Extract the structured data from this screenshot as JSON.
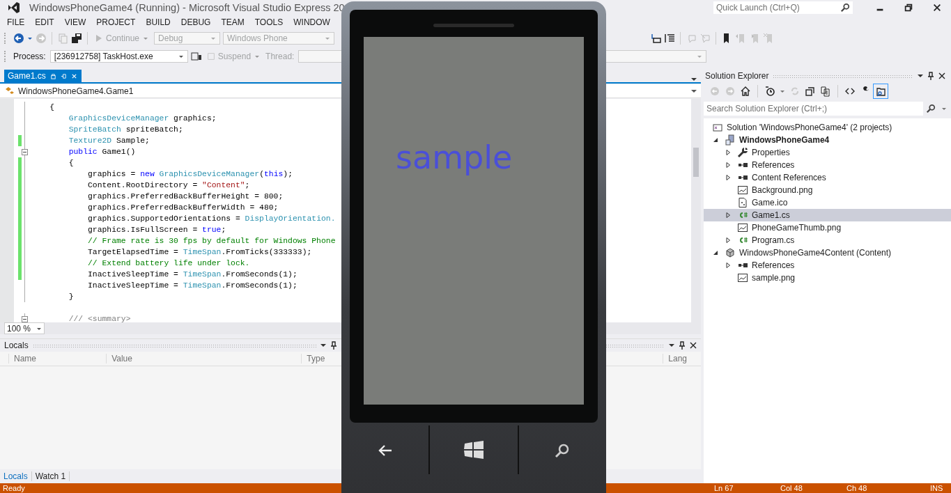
{
  "window": {
    "title": "WindowsPhoneGame4 (Running) - Microsoft Visual Studio Express 20",
    "quick_launch": {
      "placeholder": "Quick Launch (Ctrl+Q)"
    }
  },
  "menu": [
    "FILE",
    "EDIT",
    "VIEW",
    "PROJECT",
    "BUILD",
    "DEBUG",
    "TEAM",
    "TOOLS",
    "WINDOW"
  ],
  "toolbar": {
    "continue": "Continue",
    "configuration": "Debug",
    "platform": "Windows Phone",
    "process_label": "Process:",
    "process": "[236912758] TaskHost.exe",
    "suspend": "Suspend",
    "thread_label": "Thread:"
  },
  "editor": {
    "tabs": [
      {
        "label": "Game1.cs",
        "selected": true
      }
    ],
    "navigation": "WindowsPhoneGame4.Game1",
    "zoom": "100 %",
    "lines": [
      {
        "kind": "class",
        "changed": false,
        "fold": false,
        "tokens": [
          {
            "kind": "plain",
            "text": "{"
          }
        ]
      },
      {
        "kind": "member",
        "changed": false,
        "fold": false,
        "tokens": [
          {
            "kind": "type",
            "text": "GraphicsDeviceManager"
          },
          {
            "kind": "plain",
            "text": " graphics;"
          }
        ]
      },
      {
        "kind": "member",
        "changed": false,
        "fold": false,
        "tokens": [
          {
            "kind": "type",
            "text": "SpriteBatch"
          },
          {
            "kind": "plain",
            "text": " spriteBatch;"
          }
        ]
      },
      {
        "kind": "member",
        "changed": true,
        "fold": false,
        "tokens": [
          {
            "kind": "type",
            "text": "Texture2D"
          },
          {
            "kind": "plain",
            "text": " Sample;"
          }
        ]
      },
      {
        "kind": "member",
        "changed": false,
        "fold": true,
        "tokens": [
          {
            "kind": "keyword",
            "text": "public"
          },
          {
            "kind": "plain",
            "text": " Game1()"
          }
        ]
      },
      {
        "kind": "member",
        "changed": true,
        "fold": false,
        "tokens": [
          {
            "kind": "plain",
            "text": "{"
          }
        ]
      },
      {
        "kind": "statement",
        "changed": true,
        "fold": false,
        "tokens": [
          {
            "kind": "plain",
            "text": "graphics = "
          },
          {
            "kind": "keyword",
            "text": "new"
          },
          {
            "kind": "type",
            "text": " GraphicsDeviceManager"
          },
          {
            "kind": "plain",
            "text": "("
          },
          {
            "kind": "keyword",
            "text": "this"
          },
          {
            "kind": "plain",
            "text": ");"
          }
        ]
      },
      {
        "kind": "statement",
        "changed": true,
        "fold": false,
        "tokens": [
          {
            "kind": "plain",
            "text": "Content.RootDirectory = "
          },
          {
            "kind": "string",
            "text": "\"Content\""
          },
          {
            "kind": "plain",
            "text": ";"
          }
        ]
      },
      {
        "kind": "statement",
        "changed": true,
        "fold": false,
        "tokens": [
          {
            "kind": "plain",
            "text": "graphics.PreferredBackBufferHeight = 800;"
          }
        ]
      },
      {
        "kind": "statement",
        "changed": true,
        "fold": false,
        "tokens": [
          {
            "kind": "plain",
            "text": "graphics.PreferredBackBufferWidth = 480;"
          }
        ]
      },
      {
        "kind": "statement",
        "changed": true,
        "fold": false,
        "tokens": [
          {
            "kind": "plain",
            "text": "graphics.SupportedOrientations = "
          },
          {
            "kind": "type",
            "text": "DisplayOrientation."
          }
        ]
      },
      {
        "kind": "statement",
        "changed": true,
        "fold": false,
        "tokens": [
          {
            "kind": "plain",
            "text": "graphics.IsFullScreen = "
          },
          {
            "kind": "keyword",
            "text": "true"
          },
          {
            "kind": "plain",
            "text": ";"
          }
        ]
      },
      {
        "kind": "statement",
        "changed": true,
        "fold": false,
        "tokens": [
          {
            "kind": "comment",
            "text": "// Frame rate is 30 fps by default for Windows Phone"
          }
        ]
      },
      {
        "kind": "statement",
        "changed": true,
        "fold": false,
        "tokens": [
          {
            "kind": "plain",
            "text": "TargetElapsedTime = "
          },
          {
            "kind": "type",
            "text": "TimeSpan"
          },
          {
            "kind": "plain",
            "text": ".FromTicks(333333);"
          }
        ]
      },
      {
        "kind": "statement",
        "changed": true,
        "fold": false,
        "tokens": [
          {
            "kind": "comment",
            "text": "// Extend battery life under lock."
          }
        ]
      },
      {
        "kind": "statement",
        "changed": true,
        "fold": false,
        "tokens": [
          {
            "kind": "plain",
            "text": "InactiveSleepTime = "
          },
          {
            "kind": "type",
            "text": "TimeSpan"
          },
          {
            "kind": "plain",
            "text": ".FromSeconds(1);"
          }
        ]
      },
      {
        "kind": "statement",
        "changed": false,
        "fold": false,
        "tokens": [
          {
            "kind": "plain",
            "text": "InactiveSleepTime = "
          },
          {
            "kind": "type",
            "text": "TimeSpan"
          },
          {
            "kind": "plain",
            "text": ".FromSeconds(1);"
          }
        ]
      },
      {
        "kind": "member",
        "changed": false,
        "fold": false,
        "tokens": [
          {
            "kind": "plain",
            "text": "}"
          }
        ]
      },
      {
        "kind": "member_spaced",
        "changed": false,
        "fold": true,
        "tokens": [
          {
            "kind": "doc",
            "text": "/// <summary>"
          }
        ]
      }
    ]
  },
  "locals": {
    "title": "Locals",
    "columns": [
      "Name",
      "Value",
      "Type"
    ]
  },
  "second_panel": {
    "columns": [
      "Lang"
    ]
  },
  "bottom_tabs": [
    {
      "label": "Locals",
      "selected": true
    },
    {
      "label": "Watch 1",
      "selected": false
    }
  ],
  "solution_explorer": {
    "title": "Solution Explorer",
    "search": {
      "placeholder": "Search Solution Explorer (Ctrl+;)"
    },
    "tree": [
      {
        "label": "Solution 'WindowsPhoneGame4' (2 projects)",
        "kind": "solution",
        "selected": false,
        "children": [
          {
            "label": "WindowsPhoneGame4",
            "kind": "project",
            "expanded": true,
            "selected": false,
            "children": [
              {
                "label": "Properties",
                "kind": "properties",
                "expanded": false,
                "selected": false
              },
              {
                "label": "References",
                "kind": "references",
                "expanded": false,
                "selected": false
              },
              {
                "label": "Content References",
                "kind": "references",
                "expanded": false,
                "selected": false
              },
              {
                "label": "Background.png",
                "kind": "image",
                "selected": false
              },
              {
                "label": "Game.ico",
                "kind": "ico",
                "selected": false
              },
              {
                "label": "Game1.cs",
                "kind": "csharp",
                "expanded": false,
                "selected": true
              },
              {
                "label": "PhoneGameThumb.png",
                "kind": "image",
                "selected": false
              },
              {
                "label": "Program.cs",
                "kind": "csharp",
                "expanded": false,
                "selected": false
              }
            ]
          },
          {
            "label": "WindowsPhoneGame4Content (Content)",
            "kind": "content",
            "expanded": true,
            "selected": false,
            "children": [
              {
                "label": "References",
                "kind": "references",
                "expanded": false,
                "selected": false
              },
              {
                "label": "sample.png",
                "kind": "image",
                "selected": false
              }
            ]
          }
        ]
      }
    ]
  },
  "emulator": {
    "screen_text": "sample"
  },
  "status_bar": {
    "message": "Ready",
    "line": "Ln 67",
    "column": "Col 48",
    "char": "Ch 48",
    "mode": "INS"
  }
}
